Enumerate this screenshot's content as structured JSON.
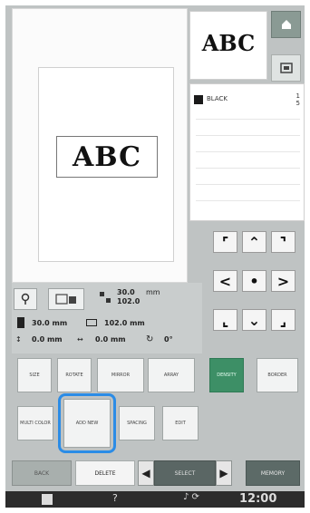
{
  "preview": {
    "text": "ABC"
  },
  "thumbnail": {
    "text": "ABC"
  },
  "header": {
    "home_icon": "home-icon",
    "fit_icon": "fit-screen-icon"
  },
  "color_list": {
    "color_name": "BLACK",
    "color_num_top": "1",
    "color_num_bottom": "5"
  },
  "pad": {
    "up": "⌃",
    "down": "⌄",
    "left": "<",
    "right": ">",
    "center": "•",
    "ul": "⌜",
    "ur": "⌝",
    "ll": "⌞",
    "lr": "⌟"
  },
  "info": {
    "size_width": "30.0",
    "size_height": "102.0",
    "size_unit": "mm",
    "dim_width": "30.0 mm",
    "dim_height": "102.0 mm",
    "offset_x": "0.0 mm",
    "offset_y": "0.0 mm",
    "rotation": "0°"
  },
  "functions": {
    "row1": [
      "SIZE",
      "ROTATE",
      "MIRROR",
      "ARRAY",
      "DENSITY",
      "BORDER"
    ],
    "row2": [
      "MULTI COLOR",
      "ADD NEW",
      "SPACING",
      "EDIT"
    ]
  },
  "bottom": {
    "back": "BACK",
    "delete": "DELETE",
    "select": "SELECT",
    "memory": "MEMORY"
  },
  "status": {
    "time": "12:00",
    "help": "?"
  }
}
